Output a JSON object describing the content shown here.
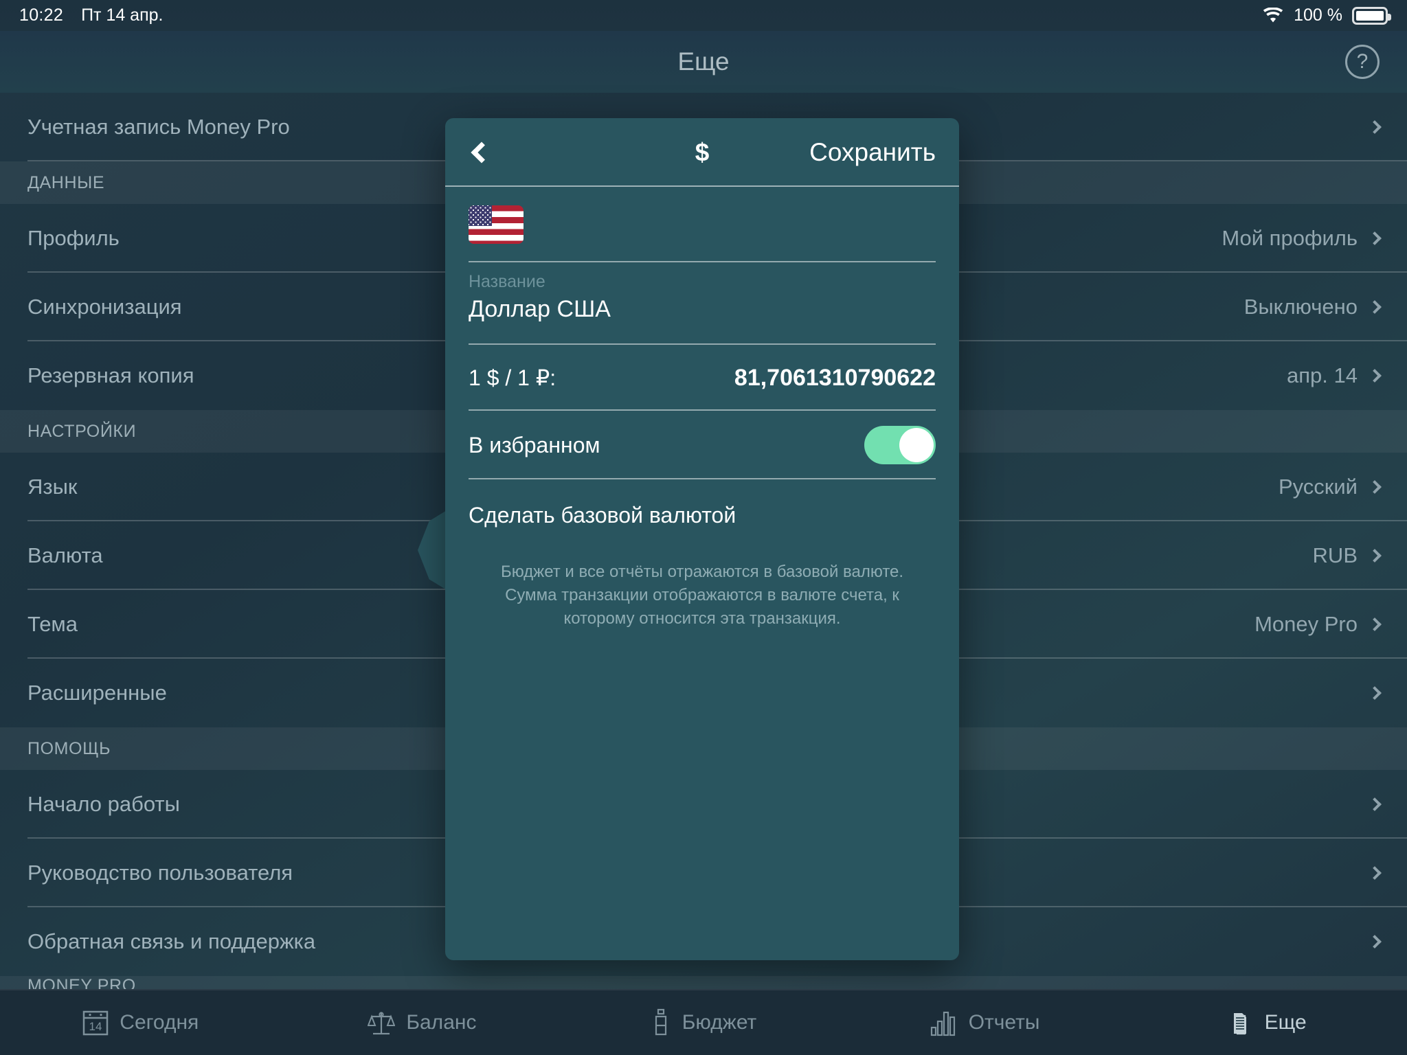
{
  "status_bar": {
    "time": "10:22",
    "date": "Пт 14 апр.",
    "battery_text": "100 %",
    "wifi_icon": "wifi-icon",
    "battery_icon": "battery-full-icon"
  },
  "header": {
    "title": "Еще",
    "help_icon": "question-mark-icon"
  },
  "settings_list": [
    {
      "type": "row",
      "label": "Учетная запись Money Pro",
      "value": ""
    },
    {
      "type": "section",
      "label": "ДАННЫЕ"
    },
    {
      "type": "row",
      "label": "Профиль",
      "value": "Мой профиль"
    },
    {
      "type": "row",
      "label": "Синхронизация",
      "value": "Выключено"
    },
    {
      "type": "row",
      "label": "Резервная копия",
      "value": "апр. 14"
    },
    {
      "type": "section",
      "label": "НАСТРОЙКИ"
    },
    {
      "type": "row",
      "label": "Язык",
      "value": "Русский"
    },
    {
      "type": "row",
      "label": "Валюта",
      "value": "RUB"
    },
    {
      "type": "row",
      "label": "Тема",
      "value": "Money Pro"
    },
    {
      "type": "row",
      "label": "Расширенные",
      "value": ""
    },
    {
      "type": "section",
      "label": "ПОМОЩЬ"
    },
    {
      "type": "row",
      "label": "Начало работы",
      "value": ""
    },
    {
      "type": "row",
      "label": "Руководство пользователя",
      "value": ""
    },
    {
      "type": "row",
      "label": "Обратная связь и поддержка",
      "value": ""
    },
    {
      "type": "section",
      "label": "MONEY PRO"
    }
  ],
  "popover": {
    "back_icon": "back-chevron-icon",
    "title": "$",
    "save_label": "Сохранить",
    "flag_icon": "us-flag-icon",
    "name_label": "Название",
    "name_value": "Доллар США",
    "rate_label": "1 $ / 1 ₽:",
    "rate_value": "81,7061310790622",
    "favorite_label": "В избранном",
    "favorite_on": true,
    "toggle_on_color": "#72e0b0",
    "make_base_label": "Сделать базовой валютой",
    "note": "Бюджет и все отчёты отражаются в базовой валюте. Сумма транзакции отображаются в валюте счета, к которому относится эта транзакция."
  },
  "tabbar": [
    {
      "label": "Сегодня",
      "icon": "calendar-icon",
      "day": "14",
      "active": false
    },
    {
      "label": "Баланс",
      "icon": "scales-icon",
      "active": false
    },
    {
      "label": "Бюджет",
      "icon": "bottle-icon",
      "active": false
    },
    {
      "label": "Отчеты",
      "icon": "bar-chart-icon",
      "active": false
    },
    {
      "label": "Еще",
      "icon": "documents-icon",
      "active": true
    }
  ]
}
